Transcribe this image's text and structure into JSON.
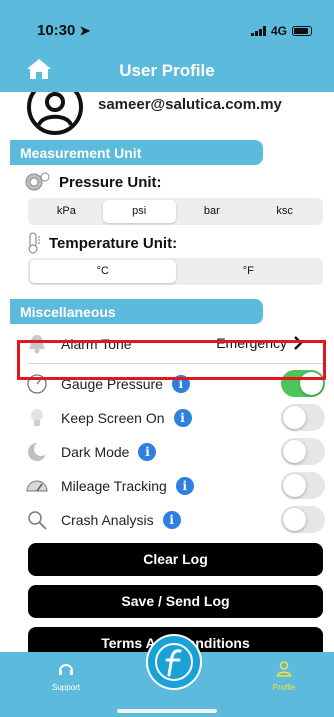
{
  "status": {
    "time": "10:30",
    "network": "4G"
  },
  "header": {
    "title": "User Profile"
  },
  "profile": {
    "email": "sameer@salutica.com.my"
  },
  "measurement": {
    "section_title": "Measurement Unit",
    "pressure_label": "Pressure Unit:",
    "pressure_options": [
      "kPa",
      "psi",
      "bar",
      "ksc"
    ],
    "pressure_selected": "psi",
    "temperature_label": "Temperature Unit:",
    "temperature_options": [
      "°C",
      "°F"
    ],
    "temperature_selected": "°C"
  },
  "misc": {
    "section_title": "Miscellaneous",
    "alarm_label": "Alarm Tone",
    "alarm_value": "Emergency",
    "items": [
      {
        "label": "Gauge Pressure",
        "on": true
      },
      {
        "label": "Keep Screen On",
        "on": false
      },
      {
        "label": "Dark Mode",
        "on": false
      },
      {
        "label": "Mileage Tracking",
        "on": false
      },
      {
        "label": "Crash Analysis",
        "on": false
      }
    ]
  },
  "actions": {
    "clear_log": "Clear Log",
    "save_log": "Save / Send Log",
    "terms": "Terms And Conditions"
  },
  "tabbar": {
    "support": "Support",
    "profile": "Profile"
  },
  "colors": {
    "primary": "#5cbbdc",
    "highlight": "#e6141b",
    "toggle_on": "#4cc65a",
    "info": "#2f7fe0",
    "active_tab": "#f2e23a"
  }
}
